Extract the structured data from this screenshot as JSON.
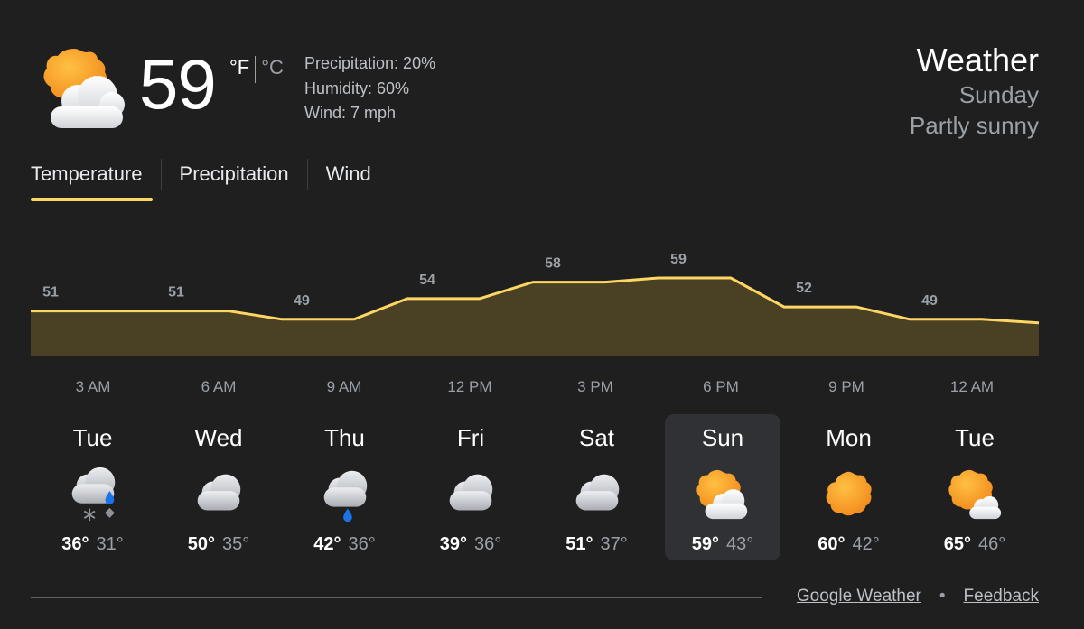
{
  "current": {
    "temperature": "59",
    "unit_f": "°F",
    "unit_c": "°C",
    "precipitation": "Precipitation: 20%",
    "humidity": "Humidity: 60%",
    "wind": "Wind: 7 mph",
    "icon": "partly-sunny-icon"
  },
  "header": {
    "title": "Weather",
    "day": "Sunday",
    "condition": "Partly sunny"
  },
  "tabs": [
    {
      "label": "Temperature",
      "active": true
    },
    {
      "label": "Precipitation",
      "active": false
    },
    {
      "label": "Wind",
      "active": false
    }
  ],
  "chart_data": {
    "type": "area",
    "x": [
      "3 AM",
      "6 AM",
      "9 AM",
      "12 PM",
      "3 PM",
      "6 PM",
      "9 PM",
      "12 AM"
    ],
    "values": [
      51,
      51,
      49,
      54,
      58,
      59,
      52,
      49
    ],
    "line_color": "#fdd663",
    "fill_color": "#4a4125"
  },
  "days": [
    {
      "name": "Tue",
      "high": "36°",
      "low": "31°",
      "icon": "rain-snow-icon",
      "selected": false
    },
    {
      "name": "Wed",
      "high": "50°",
      "low": "35°",
      "icon": "cloudy-icon",
      "selected": false
    },
    {
      "name": "Thu",
      "high": "42°",
      "low": "36°",
      "icon": "rain-icon",
      "selected": false
    },
    {
      "name": "Fri",
      "high": "39°",
      "low": "36°",
      "icon": "cloudy-icon",
      "selected": false
    },
    {
      "name": "Sat",
      "high": "51°",
      "low": "37°",
      "icon": "cloudy-icon",
      "selected": false
    },
    {
      "name": "Sun",
      "high": "59°",
      "low": "43°",
      "icon": "partly-sunny-icon",
      "selected": true
    },
    {
      "name": "Mon",
      "high": "60°",
      "low": "42°",
      "icon": "sunny-icon",
      "selected": false
    },
    {
      "name": "Tue",
      "high": "65°",
      "low": "46°",
      "icon": "mostly-sunny-icon",
      "selected": false
    }
  ],
  "footer": {
    "source_link": "Google Weather",
    "separator": "•",
    "feedback_link": "Feedback"
  },
  "colors": {
    "background": "#1f1f1f",
    "accent": "#fdd663",
    "selected_day_bg": "#303134"
  }
}
